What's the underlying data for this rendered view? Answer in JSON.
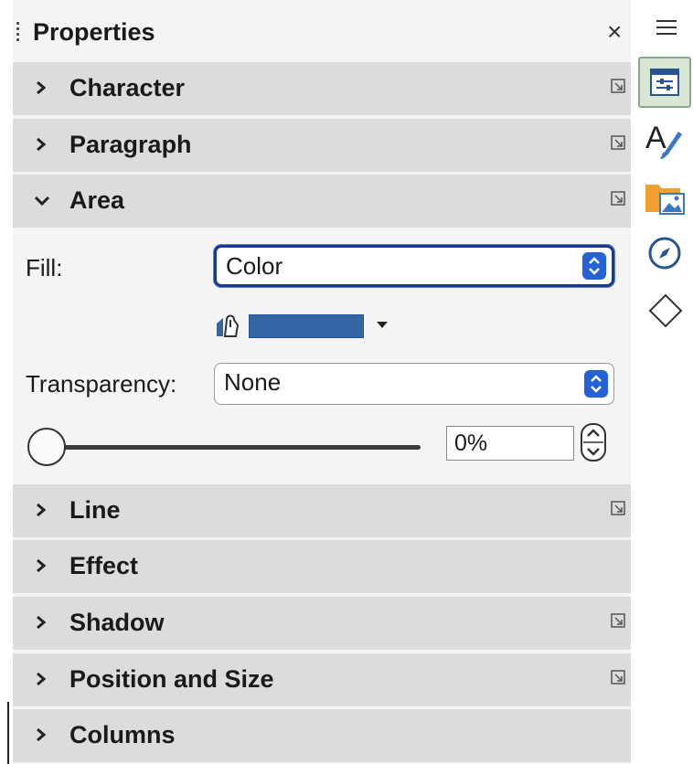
{
  "panel": {
    "title": "Properties",
    "close_symbol": "×"
  },
  "sections": {
    "character": "Character",
    "paragraph": "Paragraph",
    "area": "Area",
    "line": "Line",
    "effect": "Effect",
    "shadow": "Shadow",
    "position_size": "Position and Size",
    "columns": "Columns"
  },
  "area": {
    "fill_label": "Fill:",
    "fill_value": "Color",
    "fill_color": "#3465a4",
    "transparency_label": "Transparency:",
    "transparency_value": "None",
    "transparency_percent": "0%",
    "transparency_slider_fraction": 0.0
  },
  "sidebar_tabs": [
    {
      "name": "properties-icon",
      "active": true
    },
    {
      "name": "styles-icon",
      "active": false
    },
    {
      "name": "gallery-icon",
      "active": false
    },
    {
      "name": "navigator-icon",
      "active": false
    },
    {
      "name": "shapes-icon",
      "active": false
    }
  ],
  "colors": {
    "accent": "#2463d4",
    "focus_border": "#1a3a8c",
    "section_bg": "#dcdcdc"
  }
}
